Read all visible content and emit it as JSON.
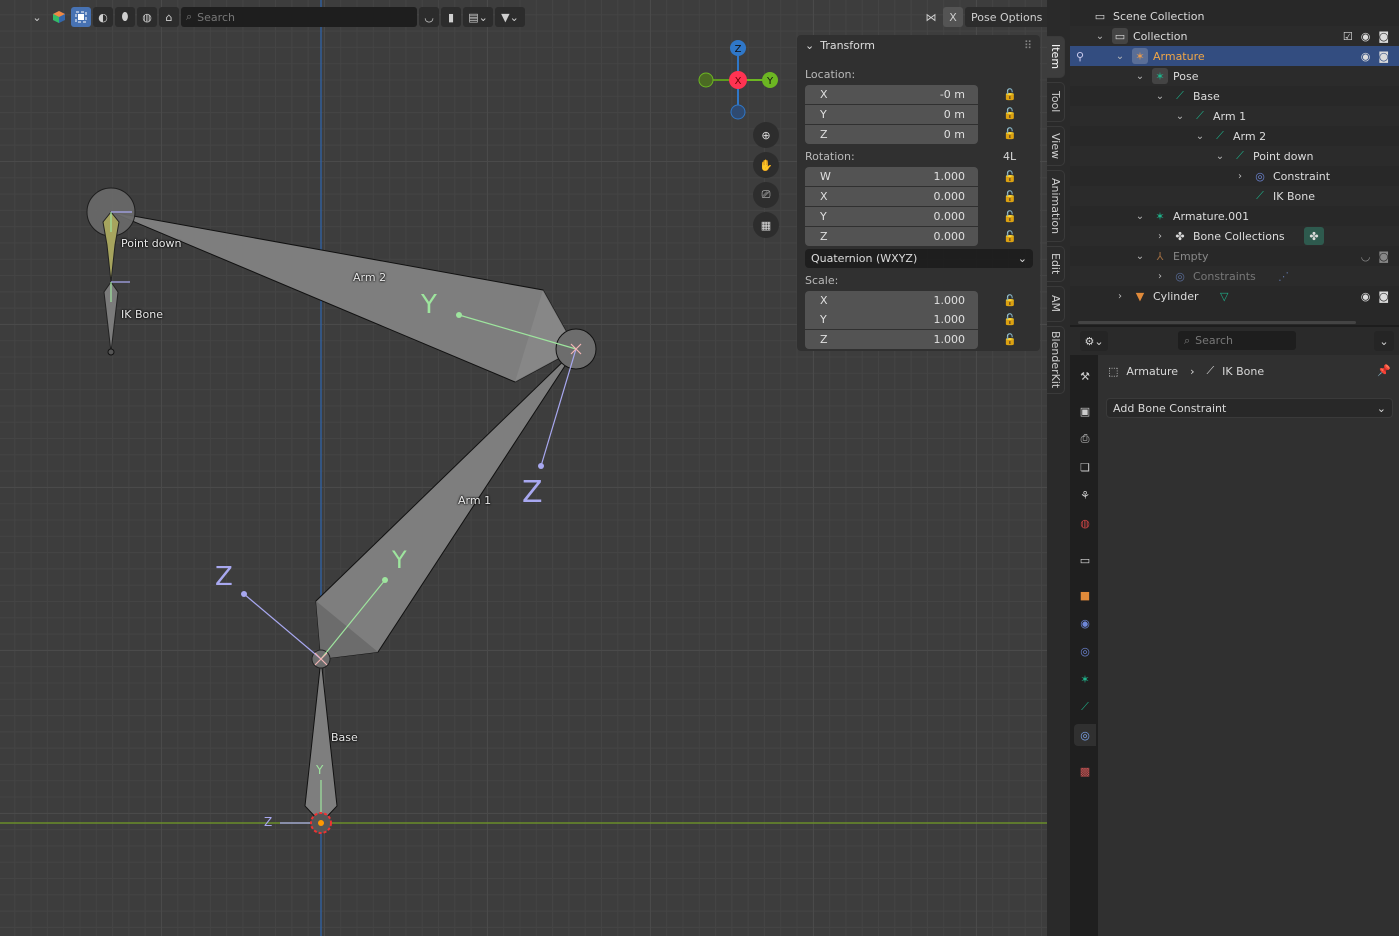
{
  "viewport_header": {
    "search_placeholder": "Search",
    "pose_options_label": "Pose Options",
    "x_mirror_label": "X"
  },
  "gizmo": {
    "x": "X",
    "y": "Y",
    "z": "Z"
  },
  "viewport_bones": {
    "labels": [
      "Point down",
      "IK Bone",
      "Arm 2",
      "Arm 1",
      "Base"
    ],
    "axis_labels": {
      "y": "Y",
      "z": "Z"
    }
  },
  "n_panel": {
    "title": "Transform",
    "location_label": "Location:",
    "location": [
      {
        "axis": "X",
        "value": "-0 m"
      },
      {
        "axis": "Y",
        "value": "0 m"
      },
      {
        "axis": "Z",
        "value": "0 m"
      }
    ],
    "rotation_label": "Rotation:",
    "rotation_lock_label": "4L",
    "rotation": [
      {
        "axis": "W",
        "value": "1.000"
      },
      {
        "axis": "X",
        "value": "0.000"
      },
      {
        "axis": "Y",
        "value": "0.000"
      },
      {
        "axis": "Z",
        "value": "0.000"
      }
    ],
    "rotation_mode": "Quaternion (WXYZ)",
    "scale_label": "Scale:",
    "scale": [
      {
        "axis": "X",
        "value": "1.000"
      },
      {
        "axis": "Y",
        "value": "1.000"
      },
      {
        "axis": "Z",
        "value": "1.000"
      }
    ]
  },
  "sidebar_tabs": [
    "Item",
    "Tool",
    "View",
    "Animation",
    "Edit",
    "AM",
    "BlenderKit"
  ],
  "outliner": {
    "rows": [
      {
        "label": "Scene Collection",
        "icon": "scene-collection-icon"
      },
      {
        "label": "Collection",
        "icon": "collection-icon"
      },
      {
        "label": "Armature",
        "icon": "armature-object-icon"
      },
      {
        "label": "Pose",
        "icon": "pose-icon"
      },
      {
        "label": "Base",
        "icon": "bone-icon"
      },
      {
        "label": "Arm 1",
        "icon": "bone-icon"
      },
      {
        "label": "Arm 2",
        "icon": "bone-icon"
      },
      {
        "label": "Point down",
        "icon": "bone-icon"
      },
      {
        "label": "Constraint",
        "icon": "constraint-icon"
      },
      {
        "label": "IK Bone",
        "icon": "bone-icon"
      },
      {
        "label": "Armature.001",
        "icon": "armature-data-icon"
      },
      {
        "label": "Bone Collections",
        "icon": "bone-collections-icon"
      },
      {
        "label": "Empty",
        "icon": "empty-icon"
      },
      {
        "label": "Constraints",
        "icon": "constraint-icon"
      },
      {
        "label": "Cylinder",
        "icon": "mesh-object-icon"
      }
    ]
  },
  "properties": {
    "search_placeholder": "Search",
    "breadcrumb": {
      "object": "Armature",
      "bone": "IK Bone"
    },
    "add_constraint_label": "Add Bone Constraint",
    "tabs": [
      "tool",
      "render",
      "output",
      "view-layer",
      "scene",
      "world",
      "collection",
      "object",
      "physics",
      "object-constraints",
      "object-data",
      "bone",
      "bone-constraints",
      "texture"
    ],
    "active_tab": "bone-constraints"
  },
  "colors": {
    "accent": "#4772b3",
    "selection": "#334d80",
    "bone_green": "#1fb28a",
    "armature_orange": "#e69a4d",
    "axis_x": "#ff3352",
    "axis_y": "#8bdc00",
    "axis_z": "#2890ff"
  }
}
